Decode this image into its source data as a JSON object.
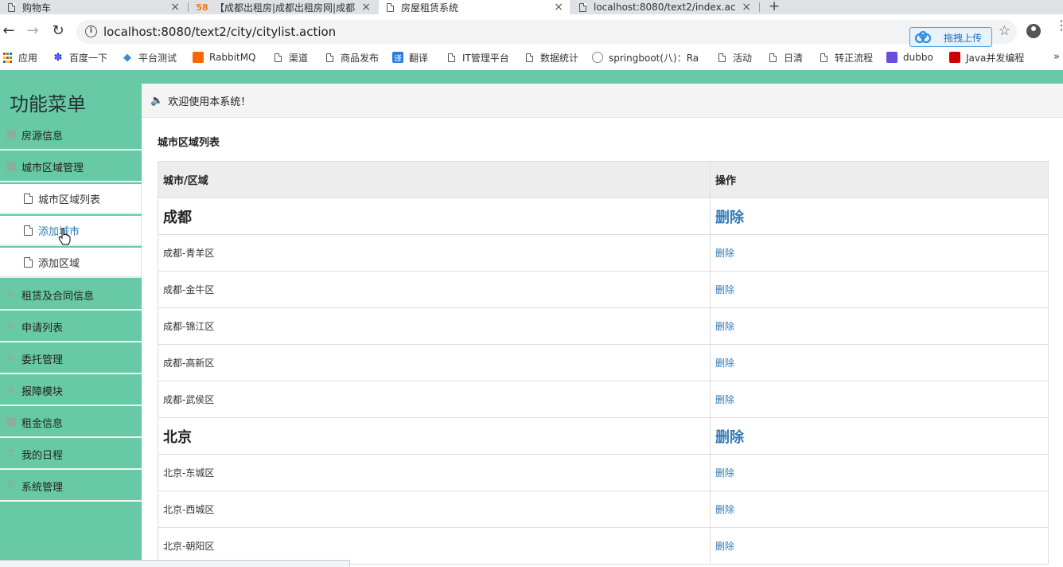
{
  "browser": {
    "tabs": [
      {
        "title": "购物车",
        "active": false
      },
      {
        "title": "【成都出租房|成都出租房网|成都",
        "active": false
      },
      {
        "title": "房屋租赁系统",
        "active": true
      },
      {
        "title": "localhost:8080/text2/index.act",
        "active": false
      }
    ],
    "favicon_58": "58",
    "url": "localhost:8080/text2/city/citylist.action",
    "upload_label": "拖拽上传",
    "bookmarks": [
      {
        "label": "应用",
        "icon": "apps-grid-icon"
      },
      {
        "label": "百度一下",
        "icon": "baidu-paw-icon"
      },
      {
        "label": "平台测试",
        "icon": "diamond-icon"
      },
      {
        "label": "RabbitMQ",
        "icon": "rabbitmq-icon"
      },
      {
        "label": "渠道",
        "icon": "page-icon"
      },
      {
        "label": "商品发布",
        "icon": "page-icon"
      },
      {
        "label": "翻译",
        "icon": "translate-icon"
      },
      {
        "label": "IT管理平台",
        "icon": "page-icon"
      },
      {
        "label": "数据统计",
        "icon": "page-icon"
      },
      {
        "label": "springboot(八)：Ra",
        "icon": "site-icon"
      },
      {
        "label": "活动",
        "icon": "page-icon"
      },
      {
        "label": "日清",
        "icon": "page-icon"
      },
      {
        "label": "转正流程",
        "icon": "page-icon"
      },
      {
        "label": "dubbo",
        "icon": "dubbo-icon"
      },
      {
        "label": "Java并发编程",
        "icon": "csdn-icon"
      }
    ],
    "bookmark_more": "»",
    "glyph_new_tab": "+",
    "glyph_close": "×",
    "glyph_info": "i",
    "glyph_star": "☆",
    "glyph_kebab": "⋮",
    "glyph_back": "←",
    "glyph_forward": "→",
    "glyph_reload": "↻",
    "translate_char": "译"
  },
  "sidebar": {
    "title": "功能菜单",
    "items": [
      {
        "label": "房源信息",
        "icon": "square-icon"
      },
      {
        "label": "城市区域管理",
        "icon": "square-icon"
      },
      {
        "label": "租赁及合同信息",
        "icon": "gear-icon"
      },
      {
        "label": "申请列表",
        "icon": "gear-icon"
      },
      {
        "label": "委托管理",
        "icon": "gear-icon"
      },
      {
        "label": "报障模块",
        "icon": "gear-icon"
      },
      {
        "label": "租金信息",
        "icon": "square-icon"
      },
      {
        "label": "我的日程",
        "icon": "gear-icon"
      },
      {
        "label": "系统管理",
        "icon": "gear-icon"
      }
    ],
    "sub_items": [
      {
        "label": "城市区域列表"
      },
      {
        "label": "添加城市"
      },
      {
        "label": "添加区域"
      }
    ],
    "glyph_gear": "✿"
  },
  "main": {
    "welcome": "欢迎使用本系统！",
    "glyph_speaker": "🔈",
    "section_title": "城市区域列表",
    "table": {
      "headers": [
        "城市/区域",
        "操作"
      ],
      "delete_label": "删除",
      "rows": [
        {
          "name": "成都",
          "is_city": true
        },
        {
          "name": "成都-青羊区",
          "is_city": false
        },
        {
          "name": "成都-金牛区",
          "is_city": false
        },
        {
          "name": "成都-锦江区",
          "is_city": false
        },
        {
          "name": "成都-高新区",
          "is_city": false
        },
        {
          "name": "成都-武侯区",
          "is_city": false
        },
        {
          "name": "北京",
          "is_city": true
        },
        {
          "name": "北京-东城区",
          "is_city": false
        },
        {
          "name": "北京-西城区",
          "is_city": false
        },
        {
          "name": "北京-朝阳区",
          "is_city": false
        }
      ]
    }
  },
  "colors": {
    "sidebar_bg": "#68c9a6",
    "link": "#337ab7",
    "header_bg": "#ededed"
  }
}
